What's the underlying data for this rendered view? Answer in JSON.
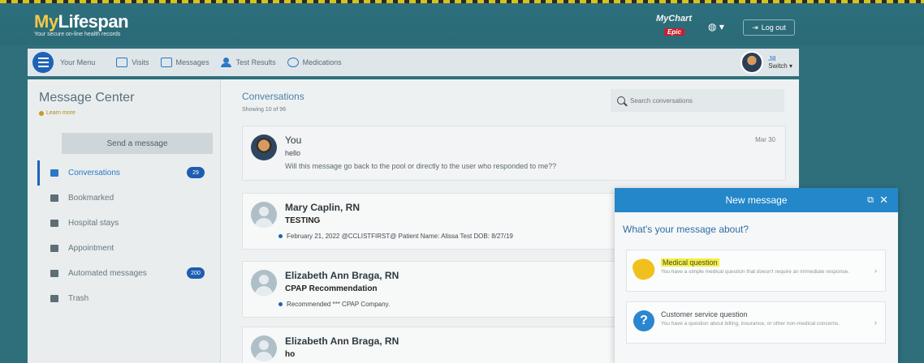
{
  "brand": {
    "logo_prefix": "My",
    "logo_suffix": "Lifespan",
    "tagline": "Your secure on-line health records",
    "mychart": "MyChart",
    "epic": "Epic"
  },
  "header": {
    "globe_label": "▾",
    "logout_label": "Log out"
  },
  "nav": {
    "menu_label": "Your Menu",
    "items": [
      {
        "label": "Visits"
      },
      {
        "label": "Messages"
      },
      {
        "label": "Test Results"
      },
      {
        "label": "Medications"
      }
    ],
    "user": {
      "name": "Jill",
      "switch_label": "Switch ▾"
    }
  },
  "sidebar": {
    "title": "Message Center",
    "learn_more": "Learn more",
    "send_button": "Send a message",
    "items": [
      {
        "label": "Conversations",
        "badge": "29"
      },
      {
        "label": "Bookmarked"
      },
      {
        "label": "Hospital stays"
      },
      {
        "label": "Appointment"
      },
      {
        "label": "Automated messages",
        "badge": "200"
      },
      {
        "label": "Trash"
      }
    ]
  },
  "conversations": {
    "title": "Conversations",
    "count": "Showing 10 of 96",
    "search_placeholder": "Search conversations",
    "list": [
      {
        "name": "You",
        "subject": "hello",
        "message": "Will this message go back to the pool or directly to the user who responded to me??",
        "date": "Mar 30"
      },
      {
        "name": "Mary Caplin, RN",
        "subject": "TESTING",
        "preview": "February 21, 2022 @CCLISTFIRST@ Patient Name: Alissa Test DOB: 8/27/19"
      },
      {
        "name": "Elizabeth Ann Braga, RN",
        "subject": "CPAP Recommendation",
        "preview": "Recommended *** CPAP Company."
      },
      {
        "name": "Elizabeth Ann Braga, RN",
        "subject": "ho"
      }
    ]
  },
  "modal": {
    "title": "New message",
    "question": "What's your message about?",
    "options": [
      {
        "title": "Medical question",
        "desc": "You have a simple medical question that doesn't require an immediate response."
      },
      {
        "title": "Customer service question",
        "desc": "You have a question about billing, insurance, or other non-medical concerns."
      }
    ]
  }
}
